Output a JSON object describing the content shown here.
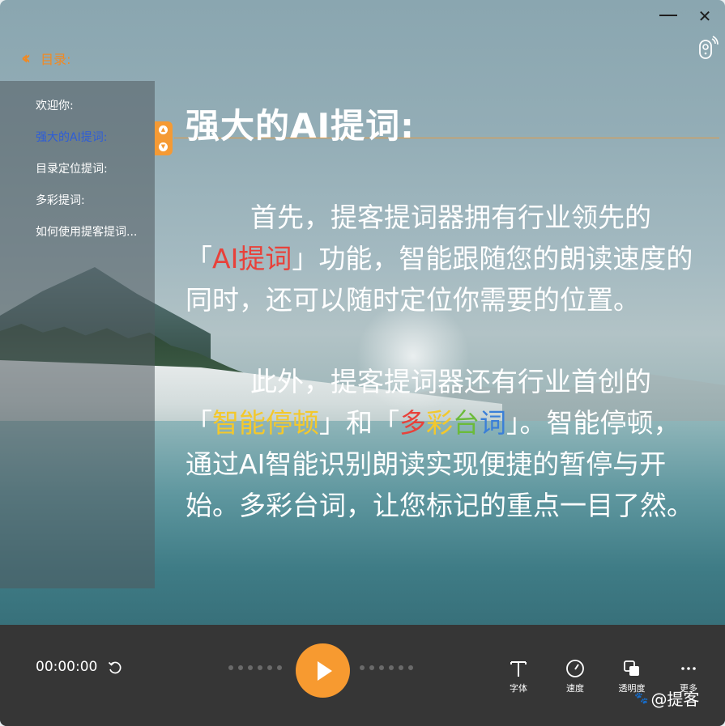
{
  "window": {
    "minimize_icon": "minimize-icon",
    "close_icon": "close-icon",
    "close_glyph": "✕",
    "remote_icon": "remote-control-icon"
  },
  "toc": {
    "toggle_icon": "double-chevron-left-icon",
    "title": "目录:",
    "items": [
      {
        "label": "欢迎你:",
        "active": false
      },
      {
        "label": "强大的AI提词:",
        "active": true
      },
      {
        "label": "目录定位提词:",
        "active": false
      },
      {
        "label": "多彩提词:",
        "active": false
      },
      {
        "label": "如何使用提客提词...",
        "active": false
      }
    ]
  },
  "script": {
    "heading": "强大的AI提词:",
    "p1": {
      "a": "首先，提客提词器拥有行业领先的",
      "b": "「",
      "c": "AI提词",
      "d": "」功能，智能跟随您的朗读速度的同时，还可以随时定位你需要的位置。"
    },
    "p2": {
      "a": "此外，提客提词器还有行业首创的",
      "b": "「",
      "c": "智能停顿",
      "d": "」和「",
      "e1": "多",
      "e2": "彩",
      "e3": "台",
      "e4": "词",
      "f": "」。智能停顿，通过AI智能识别朗读实现便捷的暂停与开始。多彩台词，让您标记的重点一目了然。"
    }
  },
  "player": {
    "time": "00:00:00",
    "reset_icon": "reset-icon",
    "play_icon": "play-icon",
    "tools": [
      {
        "label": "字体",
        "icon": "font-icon"
      },
      {
        "label": "速度",
        "icon": "speed-gauge-icon"
      },
      {
        "label": "透明度",
        "icon": "opacity-icon"
      },
      {
        "label": "更多",
        "icon": "more-dots-icon"
      }
    ]
  },
  "watermark": "@提客",
  "colors": {
    "accent": "#f79a30",
    "red": "#e8413a",
    "yellow": "#f3c82c",
    "green": "#6bbb3a",
    "blue": "#3a7fd8",
    "toc_active": "#2d5dd8"
  }
}
